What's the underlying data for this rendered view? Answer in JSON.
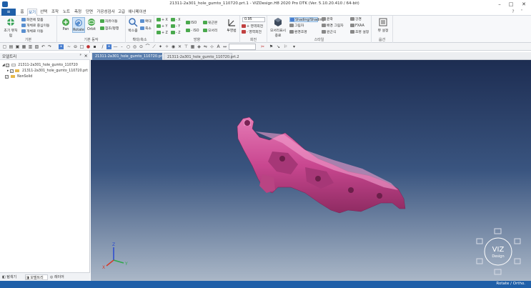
{
  "window": {
    "title": "21311-2a301_hole_gumto_110720.prt.1 - VIZDesign.H8 2020 Pro DTK (Ver. 5.10.20.410 / 64-bit)",
    "min": "–",
    "max": "□",
    "close": "✕"
  },
  "menu": {
    "file": "≡",
    "tabs": [
      "홈",
      "보기",
      "선택",
      "조작",
      "노트",
      "측정",
      "단면",
      "가공성검사",
      "고급",
      "애니메이션"
    ]
  },
  "ribbon": {
    "groups": {
      "basic": {
        "label": "기본",
        "reset_view": "초기 뷰처럼",
        "items": [
          "화면에 맞춤",
          "개체로 중심이동",
          "개체로 이동"
        ]
      },
      "mode": {
        "label": "기본 동작",
        "pan": "Pan",
        "rotate": "Rotate",
        "orbit": "Orbit",
        "items": [
          "자유이동",
          "참조/평행"
        ]
      },
      "zoom": {
        "label": "확대/축소",
        "window_zoom": "박스줌",
        "items": [
          "확대",
          "축소"
        ]
      },
      "direction": {
        "label": "방향",
        "axes": [
          "+ X",
          "- X",
          "+ Y",
          "- Y",
          "+ Z",
          "- Z"
        ],
        "iso": [
          "ISO",
          "- ISO"
        ],
        "items": [
          "윗근본",
          "모서리"
        ],
        "persp": "투영법"
      },
      "rotate": {
        "label": "회전",
        "preset": "0.95",
        "items": [
          "+ 영역회전",
          "- 영역회전"
        ]
      },
      "style": {
        "label": "스타일",
        "bigbtn": "모서리표시 종료",
        "items": [
          "Shading/Shading",
          "그림자",
          "환경조명",
          "윤곽",
          "배경 그림자",
          "원근식",
          "강경",
          "FXAA",
          "조명 설정"
        ]
      },
      "settings": {
        "label": "옵션",
        "item": "뷰 설정"
      }
    }
  },
  "sidebar": {
    "title": "모델트리",
    "pin": "ᵖ",
    "close": "×",
    "tree": [
      "21311-2a301_hole_gumto_110720",
      "21311-2a301_hole_gumto_110720.prt",
      "NonSolid"
    ],
    "tabs": [
      "탐색기",
      "모델트리",
      "레이어"
    ]
  },
  "doc_tabs": [
    "21311-2a301_hole_gumto_110720.prt.1",
    "21311-2a301_hole_gumto_110720.prt.2"
  ],
  "viewport": {
    "cube_label_1": "VIZ",
    "cube_label_2": "Design",
    "axis_x": "X",
    "axis_y": "Y",
    "axis_z": "Z",
    "part_color": "#d04f97"
  },
  "status": {
    "mode": "Rotate / Ortho."
  }
}
